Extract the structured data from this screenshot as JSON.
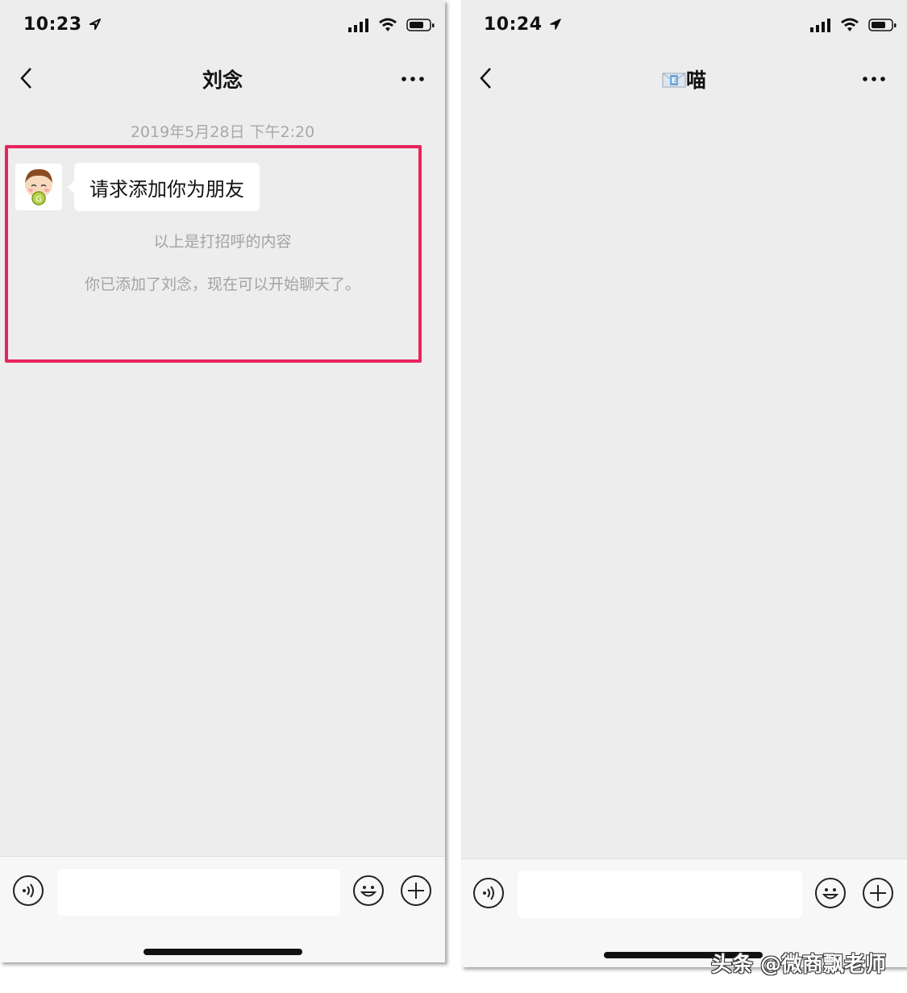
{
  "left_screen": {
    "status": {
      "time": "10:23"
    },
    "nav": {
      "title": "刘念"
    },
    "chat": {
      "timestamp": "2019年5月28日 下午2:20",
      "message": "请求添加你为朋友",
      "greeting_note": "以上是打招呼的内容",
      "added_note": "你已添加了刘念，现在可以开始聊天了。"
    },
    "input": {
      "value": ""
    }
  },
  "right_screen": {
    "status": {
      "time": "10:24"
    },
    "nav": {
      "title": "喵",
      "title_icon": "envelope-emoji-icon"
    },
    "input": {
      "value": ""
    }
  },
  "watermark": "头条 @微商飘老师",
  "colors": {
    "highlight": "#e8245c",
    "chat_bg": "#ededed"
  }
}
